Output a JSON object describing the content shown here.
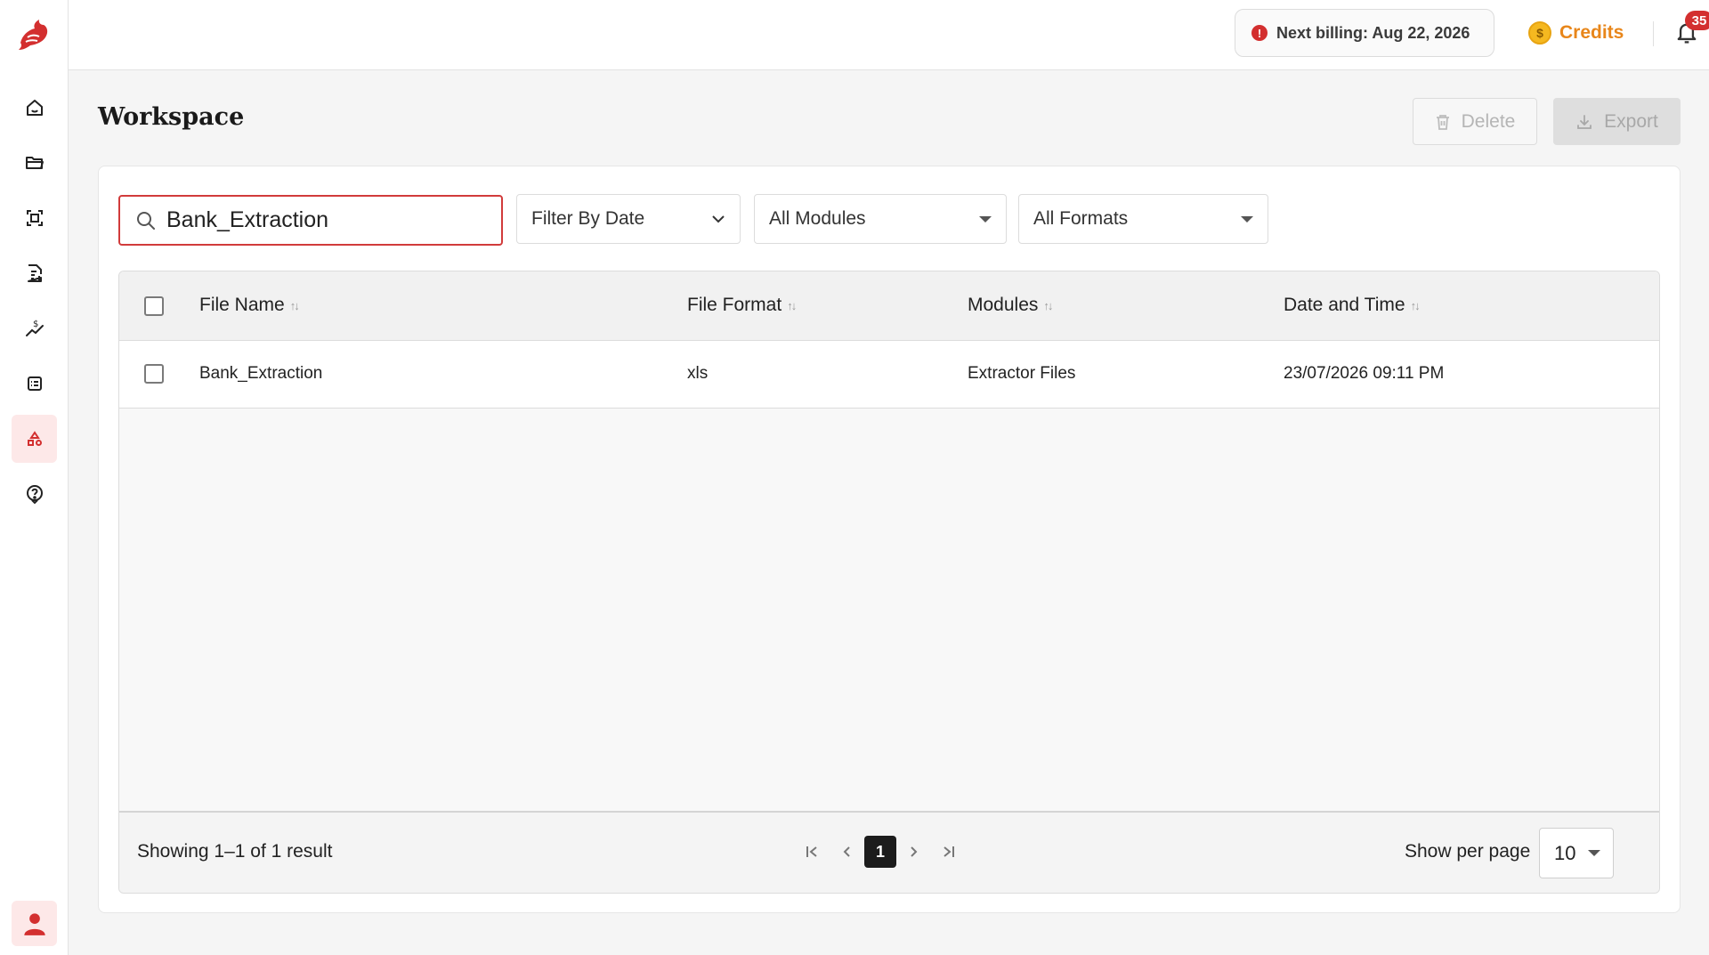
{
  "topbar": {
    "billing_text": "Next billing: Aug 22, 2026",
    "credits_label": "Credits",
    "coin_symbol": "$",
    "notification_count": "35"
  },
  "sidebar": {
    "items": [
      {
        "icon": "home-icon"
      },
      {
        "icon": "folder-icon"
      },
      {
        "icon": "scan-icon"
      },
      {
        "icon": "document-edit-icon"
      },
      {
        "icon": "finance-chart-icon"
      },
      {
        "icon": "checklist-icon"
      },
      {
        "icon": "workspace-shapes-icon",
        "active": true
      },
      {
        "icon": "help-icon"
      }
    ],
    "bottom": {
      "icon": "user-icon"
    }
  },
  "page": {
    "title": "Workspace",
    "delete_label": "Delete",
    "export_label": "Export"
  },
  "filters": {
    "search_value": "Bank_Extraction",
    "date_label": "Filter By Date",
    "modules_label": "All Modules",
    "formats_label": "All Formats"
  },
  "table": {
    "columns": [
      "File Name",
      "File Format",
      "Modules",
      "Date and Time"
    ],
    "rows": [
      {
        "file_name": "Bank_Extraction",
        "format": "xls",
        "module": "Extractor Files",
        "datetime": "23/07/2026 09:11 PM"
      }
    ]
  },
  "footer": {
    "showing": "Showing 1–1 of 1 result",
    "current_page": "1",
    "per_page_label": "Show per page",
    "per_page_value": "10"
  },
  "colors": {
    "brand_red": "#d32f2f",
    "credits_orange": "#e8861a"
  }
}
